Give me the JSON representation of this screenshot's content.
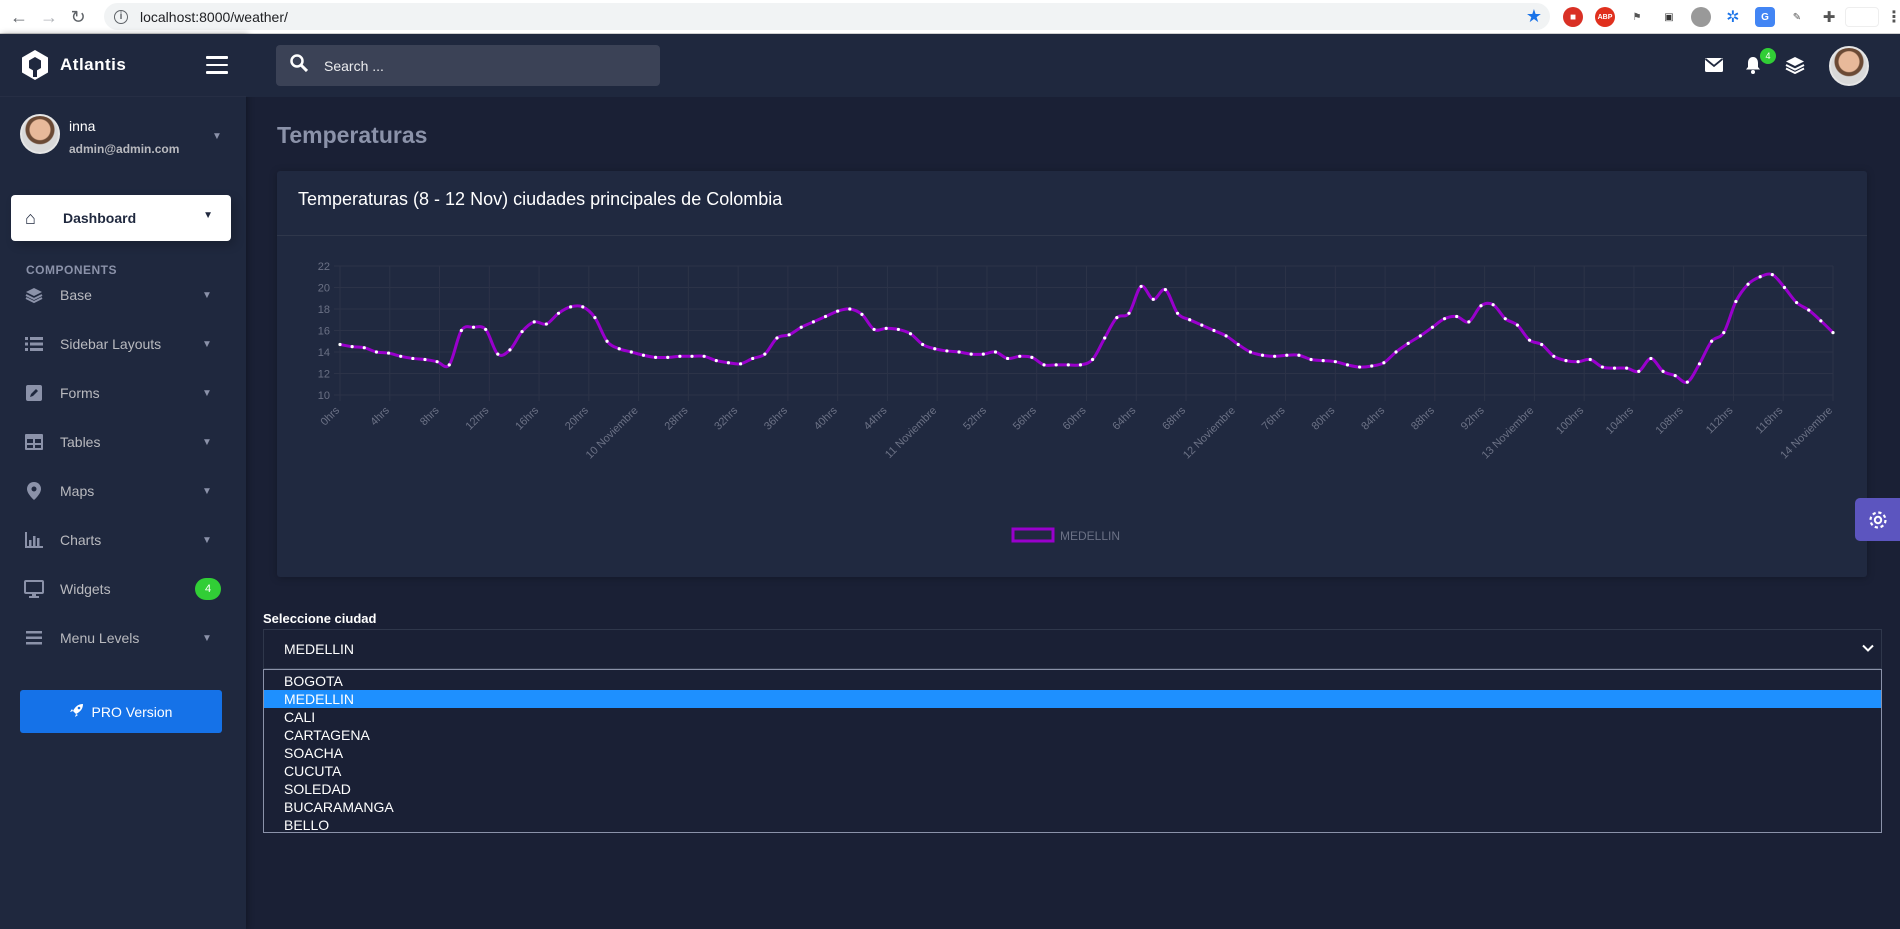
{
  "browser": {
    "url": "localhost:8000/weather/",
    "back_icon": "back-arrow-icon",
    "forward_icon": "forward-arrow-icon",
    "reload_icon": "reload-icon"
  },
  "brand": {
    "name": "Atlantis"
  },
  "user": {
    "name": "inna",
    "email": "admin@admin.com"
  },
  "sidebar": {
    "dashboard_label": "Dashboard",
    "section_label": "COMPONENTS",
    "items": [
      {
        "label": "Base",
        "icon": "layers-icon"
      },
      {
        "label": "Sidebar Layouts",
        "icon": "list-icon"
      },
      {
        "label": "Forms",
        "icon": "pen-square-icon"
      },
      {
        "label": "Tables",
        "icon": "table-icon"
      },
      {
        "label": "Maps",
        "icon": "map-marker-icon"
      },
      {
        "label": "Charts",
        "icon": "bar-chart-icon"
      },
      {
        "label": "Widgets",
        "icon": "desktop-icon",
        "badge": "4"
      },
      {
        "label": "Menu Levels",
        "icon": "bars-icon"
      }
    ],
    "pro_label": "PRO Version"
  },
  "header": {
    "search_placeholder": "Search ...",
    "notification_count": "4"
  },
  "page": {
    "title": "Temperaturas",
    "card_title": "Temperaturas (8 - 12 Nov) ciudades principales de Colombia"
  },
  "chart_data": {
    "type": "line",
    "title": "",
    "xlabel": "",
    "ylabel": "",
    "ylim": [
      10,
      22
    ],
    "yticks": [
      10,
      12,
      14,
      16,
      18,
      20,
      22
    ],
    "x_tick_labels": [
      "0hrs",
      "4hrs",
      "8hrs",
      "12hrs",
      "16hrs",
      "20hrs",
      "10 Noviembre",
      "28hrs",
      "32hrs",
      "36hrs",
      "40hrs",
      "44hrs",
      "11 Noviembre",
      "52hrs",
      "56hrs",
      "60hrs",
      "64hrs",
      "68hrs",
      "12 Noviembre",
      "76hrs",
      "80hrs",
      "84hrs",
      "88hrs",
      "92hrs",
      "13 Noviembre",
      "100hrs",
      "104hrs",
      "108hrs",
      "112hrs",
      "116hrs",
      "14 Noviembre"
    ],
    "grid": true,
    "legend_position": "bottom",
    "series": [
      {
        "name": "MEDELLIN",
        "color": "#9900cc",
        "values": [
          14.7,
          14.5,
          14.4,
          14.0,
          13.9,
          13.6,
          13.4,
          13.3,
          13.1,
          12.8,
          16.0,
          16.3,
          16.1,
          13.8,
          14.2,
          15.9,
          16.8,
          16.6,
          17.6,
          18.2,
          18.2,
          17.2,
          15.0,
          14.3,
          14.0,
          13.7,
          13.5,
          13.5,
          13.6,
          13.6,
          13.6,
          13.2,
          13.0,
          12.9,
          13.4,
          13.8,
          15.3,
          15.6,
          16.3,
          16.8,
          17.3,
          17.8,
          18.0,
          17.5,
          16.1,
          16.2,
          16.1,
          15.7,
          14.7,
          14.3,
          14.1,
          14.0,
          13.8,
          13.8,
          14.0,
          13.4,
          13.6,
          13.5,
          12.8,
          12.8,
          12.8,
          12.8,
          13.3,
          15.3,
          17.2,
          17.6,
          20.1,
          18.9,
          19.8,
          17.6,
          17.0,
          16.5,
          16.0,
          15.5,
          14.7,
          14.0,
          13.7,
          13.6,
          13.7,
          13.7,
          13.3,
          13.2,
          13.1,
          12.8,
          12.6,
          12.7,
          13.0,
          14.0,
          14.8,
          15.5,
          16.3,
          17.1,
          17.3,
          16.8,
          18.3,
          18.4,
          17.1,
          16.5,
          15.1,
          14.7,
          13.6,
          13.2,
          13.1,
          13.3,
          12.6,
          12.5,
          12.5,
          12.2,
          13.4,
          12.2,
          11.8,
          11.2,
          12.9,
          15.0,
          15.8,
          18.7,
          20.3,
          21.0,
          21.2,
          20.0,
          18.6,
          17.9,
          16.9,
          15.8
        ]
      }
    ]
  },
  "form": {
    "label": "Seleccione ciudad",
    "selected": "MEDELLIN",
    "options": [
      "BOGOTA",
      "MEDELLIN",
      "CALI",
      "CARTAGENA",
      "SOACHA",
      "CUCUTA",
      "SOLEDAD",
      "BUCARAMANGA",
      "BELLO"
    ]
  }
}
